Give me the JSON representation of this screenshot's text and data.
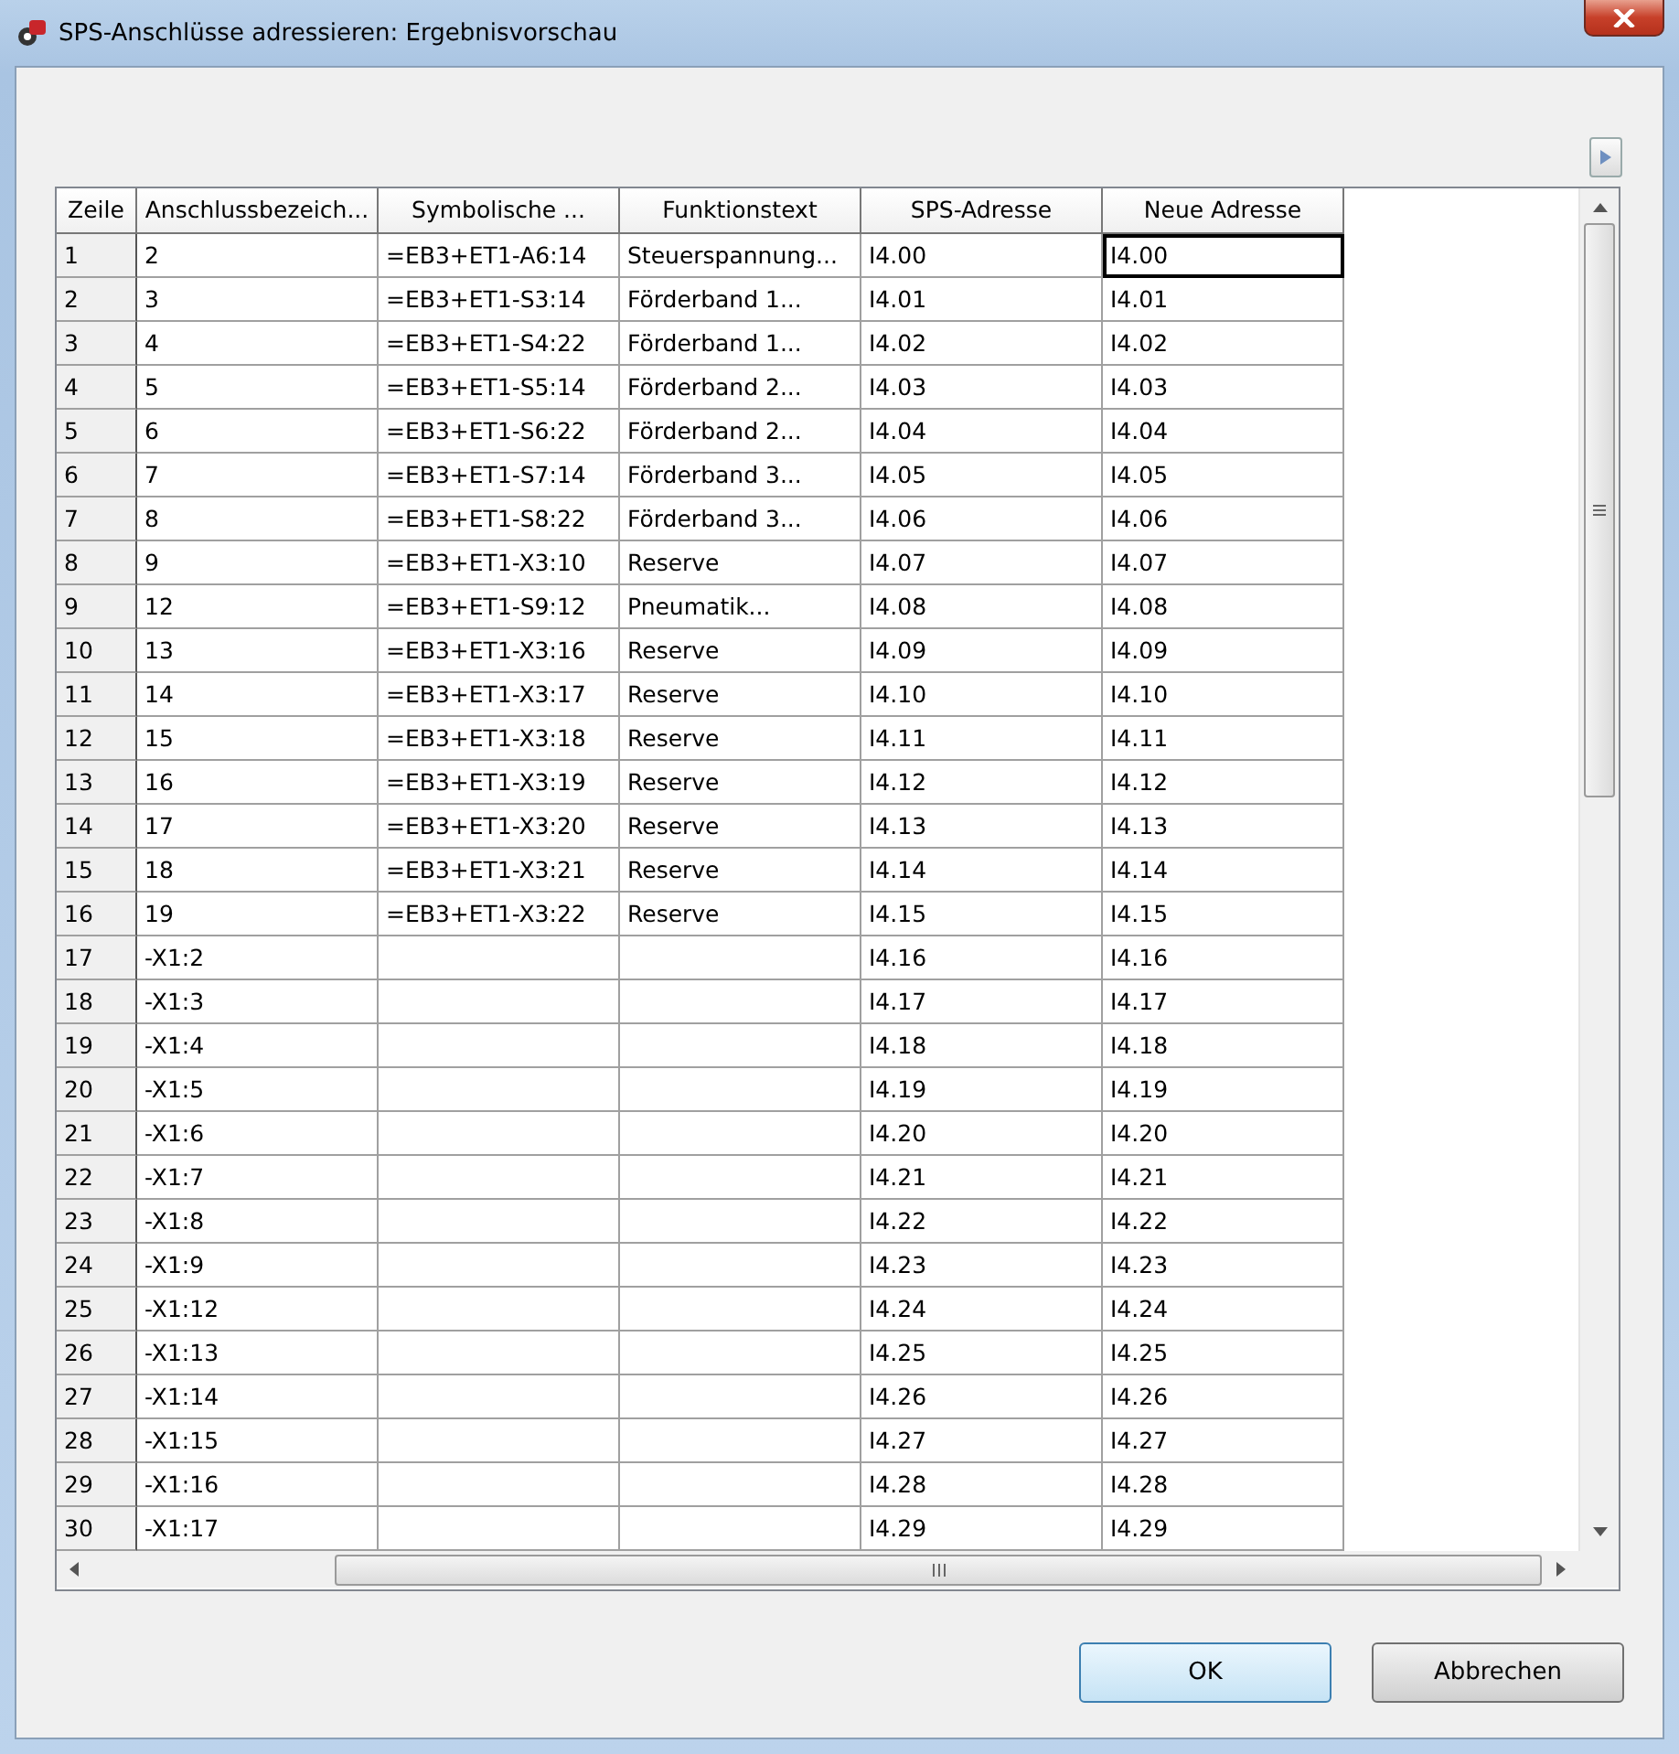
{
  "window": {
    "title": "SPS-Anschlüsse adressieren: Ergebnisvorschau"
  },
  "table": {
    "columns": [
      "Zeile",
      "Anschlussbezeich...",
      "Symbolische ...",
      "Funktionstext",
      "SPS-Adresse",
      "Neue Adresse"
    ],
    "rows": [
      {
        "cells": [
          "1",
          "2",
          "=EB3+ET1-A6:14",
          "Steuerspannung...",
          "I4.00",
          "I4.00"
        ],
        "focused": true
      },
      {
        "cells": [
          "2",
          "3",
          "=EB3+ET1-S3:14",
          "Förderband 1...",
          "I4.01",
          "I4.01"
        ],
        "focused": false
      },
      {
        "cells": [
          "3",
          "4",
          "=EB3+ET1-S4:22",
          "Förderband 1...",
          "I4.02",
          "I4.02"
        ],
        "focused": false
      },
      {
        "cells": [
          "4",
          "5",
          "=EB3+ET1-S5:14",
          "Förderband 2...",
          "I4.03",
          "I4.03"
        ],
        "focused": false
      },
      {
        "cells": [
          "5",
          "6",
          "=EB3+ET1-S6:22",
          "Förderband 2...",
          "I4.04",
          "I4.04"
        ],
        "focused": false
      },
      {
        "cells": [
          "6",
          "7",
          "=EB3+ET1-S7:14",
          "Förderband 3...",
          "I4.05",
          "I4.05"
        ],
        "focused": false
      },
      {
        "cells": [
          "7",
          "8",
          "=EB3+ET1-S8:22",
          "Förderband 3...",
          "I4.06",
          "I4.06"
        ],
        "focused": false
      },
      {
        "cells": [
          "8",
          "9",
          "=EB3+ET1-X3:10",
          "Reserve",
          "I4.07",
          "I4.07"
        ],
        "focused": false
      },
      {
        "cells": [
          "9",
          "12",
          "=EB3+ET1-S9:12",
          "Pneumatik...",
          "I4.08",
          "I4.08"
        ],
        "focused": false
      },
      {
        "cells": [
          "10",
          "13",
          "=EB3+ET1-X3:16",
          "Reserve",
          "I4.09",
          "I4.09"
        ],
        "focused": false
      },
      {
        "cells": [
          "11",
          "14",
          "=EB3+ET1-X3:17",
          "Reserve",
          "I4.10",
          "I4.10"
        ],
        "focused": false
      },
      {
        "cells": [
          "12",
          "15",
          "=EB3+ET1-X3:18",
          "Reserve",
          "I4.11",
          "I4.11"
        ],
        "focused": false
      },
      {
        "cells": [
          "13",
          "16",
          "=EB3+ET1-X3:19",
          "Reserve",
          "I4.12",
          "I4.12"
        ],
        "focused": false
      },
      {
        "cells": [
          "14",
          "17",
          "=EB3+ET1-X3:20",
          "Reserve",
          "I4.13",
          "I4.13"
        ],
        "focused": false
      },
      {
        "cells": [
          "15",
          "18",
          "=EB3+ET1-X3:21",
          "Reserve",
          "I4.14",
          "I4.14"
        ],
        "focused": false
      },
      {
        "cells": [
          "16",
          "19",
          "=EB3+ET1-X3:22",
          "Reserve",
          "I4.15",
          "I4.15"
        ],
        "focused": false
      },
      {
        "cells": [
          "17",
          "-X1:2",
          null,
          null,
          "I4.16",
          "I4.16"
        ],
        "focused": false
      },
      {
        "cells": [
          "18",
          "-X1:3",
          null,
          null,
          "I4.17",
          "I4.17"
        ],
        "focused": false
      },
      {
        "cells": [
          "19",
          "-X1:4",
          null,
          null,
          "I4.18",
          "I4.18"
        ],
        "focused": false
      },
      {
        "cells": [
          "20",
          "-X1:5",
          null,
          null,
          "I4.19",
          "I4.19"
        ],
        "focused": false
      },
      {
        "cells": [
          "21",
          "-X1:6",
          null,
          null,
          "I4.20",
          "I4.20"
        ],
        "focused": false
      },
      {
        "cells": [
          "22",
          "-X1:7",
          null,
          null,
          "I4.21",
          "I4.21"
        ],
        "focused": false
      },
      {
        "cells": [
          "23",
          "-X1:8",
          null,
          null,
          "I4.22",
          "I4.22"
        ],
        "focused": false
      },
      {
        "cells": [
          "24",
          "-X1:9",
          null,
          null,
          "I4.23",
          "I4.23"
        ],
        "focused": false
      },
      {
        "cells": [
          "25",
          "-X1:12",
          null,
          null,
          "I4.24",
          "I4.24"
        ],
        "focused": false
      },
      {
        "cells": [
          "26",
          "-X1:13",
          null,
          null,
          "I4.25",
          "I4.25"
        ],
        "focused": false
      },
      {
        "cells": [
          "27",
          "-X1:14",
          null,
          null,
          "I4.26",
          "I4.26"
        ],
        "focused": false
      },
      {
        "cells": [
          "28",
          "-X1:15",
          null,
          null,
          "I4.27",
          "I4.27"
        ],
        "focused": false
      },
      {
        "cells": [
          "29",
          "-X1:16",
          null,
          null,
          "I4.28",
          "I4.28"
        ],
        "focused": false
      },
      {
        "cells": [
          "30",
          "-X1:17",
          null,
          null,
          "I4.29",
          "I4.29"
        ],
        "focused": false
      }
    ]
  },
  "buttons": [
    {
      "label": "OK",
      "default": true
    },
    {
      "label": "Abbrechen",
      "default": false
    }
  ]
}
